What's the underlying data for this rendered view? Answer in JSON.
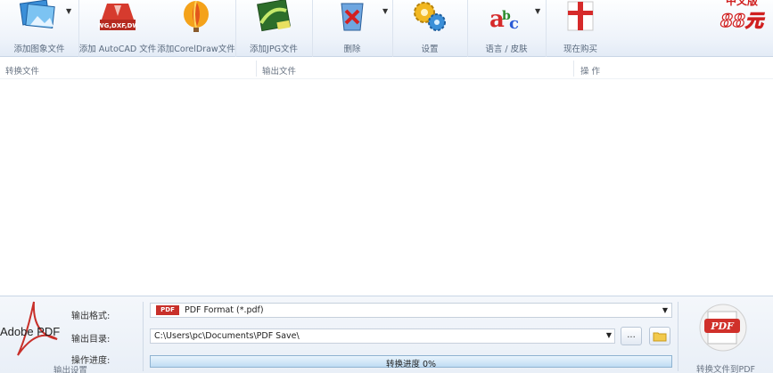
{
  "toolbar": {
    "items": [
      {
        "label": "添加图象文件",
        "icon": "images-icon",
        "dropdown": true
      },
      {
        "label": "添加 AutoCAD 文件",
        "icon": "autocad-icon",
        "icon_caption": "DWG,DXF,DWF"
      },
      {
        "label": "添加CorelDraw文件",
        "icon": "coreldraw-balloon-icon"
      },
      {
        "label": "添加JPG文件",
        "icon": "jpg-icon"
      },
      {
        "label": "删除",
        "icon": "delete-bin-icon",
        "dropdown": true
      },
      {
        "label": "设置",
        "icon": "gears-icon"
      },
      {
        "label": "语言 / 皮肤",
        "icon": "abc-language-icon",
        "dropdown": true
      },
      {
        "label": "现在购买",
        "icon": "gift-box-icon"
      }
    ],
    "promo": {
      "line1": "中文版",
      "price": "88元"
    }
  },
  "list": {
    "columns": [
      "转换文件",
      "输出文件",
      "操 作"
    ]
  },
  "output": {
    "logo_text": "Adobe PDF",
    "section_caption": "输出设置",
    "format_label": "输出格式:",
    "format_badge": "PDF",
    "format_value": "PDF Format (*.pdf)",
    "dir_label": "输出目录:",
    "dir_value": "C:\\Users\\pc\\Documents\\PDF Save\\",
    "browse_label": "...",
    "progress_label": "操作进度:",
    "progress_text": "转换进度 0%",
    "progress_value": 0
  },
  "convert": {
    "label": "转换文件到PDF",
    "icon_text": "PDF"
  },
  "colors": {
    "accent": "#3a86d0",
    "pdf_red": "#c8302a",
    "toolbar_bg": "#eef3fa"
  }
}
